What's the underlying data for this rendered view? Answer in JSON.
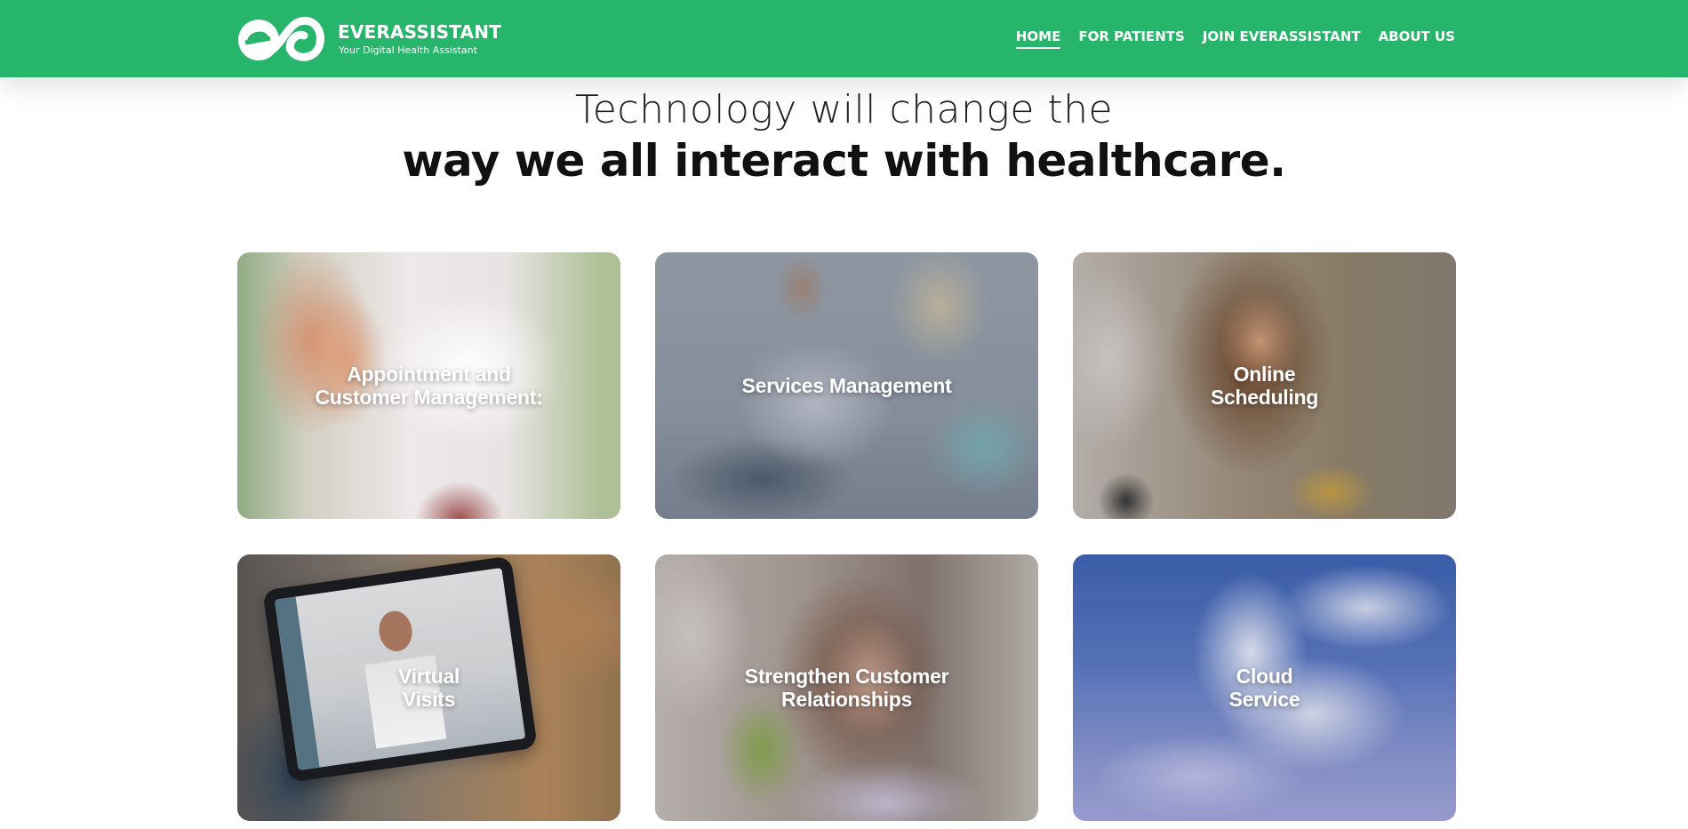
{
  "brand": {
    "name": "EVERASSISTANT",
    "tagline": "Your Digital Health Assistant",
    "color": "#27b56b"
  },
  "nav": {
    "items": [
      {
        "label": "HOME",
        "active": true
      },
      {
        "label": "FOR PATIENTS",
        "active": false
      },
      {
        "label": "JOIN EVERASSISTANT",
        "active": false
      },
      {
        "label": "ABOUT US",
        "active": false
      }
    ]
  },
  "hero": {
    "line1": "Technology will change the",
    "line2": "way we all interact with healthcare."
  },
  "cards": [
    {
      "title": "Appointment and\nCustomer Management:",
      "image": "doctor-stethoscope-photo"
    },
    {
      "title": "Services Management",
      "image": "doctor-patient-clipboard-photo"
    },
    {
      "title": "Online\nScheduling",
      "image": "woman-with-phone-photo"
    },
    {
      "title": "Virtual\nVisits",
      "image": "tablet-video-call-photo"
    },
    {
      "title": "Strengthen Customer\nRelationships",
      "image": "dental-patient-photo"
    },
    {
      "title": "Cloud\nService",
      "image": "cloudy-sky-photo"
    }
  ]
}
